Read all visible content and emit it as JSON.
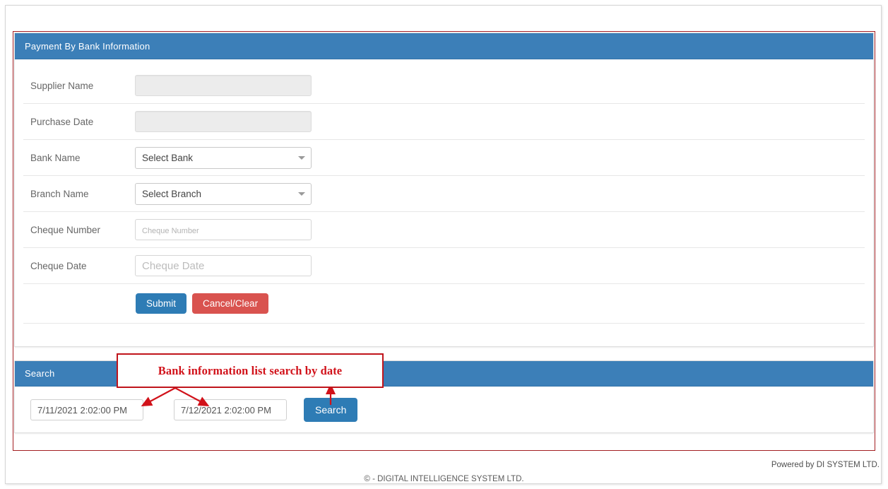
{
  "main_panel": {
    "title": "Payment By Bank Information",
    "rows": [
      {
        "label": "Supplier Name",
        "type": "text-disabled",
        "value": "",
        "placeholder": ""
      },
      {
        "label": "Purchase Date",
        "type": "text-disabled",
        "value": "",
        "placeholder": ""
      },
      {
        "label": "Bank Name",
        "type": "select",
        "value": "Select Bank",
        "placeholder": ""
      },
      {
        "label": "Branch Name",
        "type": "select",
        "value": "Select Branch",
        "placeholder": ""
      },
      {
        "label": "Cheque Number",
        "type": "text",
        "value": "",
        "placeholder": "Cheque Number"
      },
      {
        "label": "Cheque Date",
        "type": "text",
        "value": "",
        "placeholder": "Cheque Date"
      }
    ],
    "submit_label": "Submit",
    "cancel_label": "Cancel/Clear"
  },
  "search_panel": {
    "title": "Search",
    "from_date": "7/11/2021 2:02:00 PM",
    "to_date": "7/12/2021 2:02:00 PM",
    "search_label": "Search"
  },
  "annotation": {
    "text": "Bank information list search by date",
    "color": "#d1121a"
  },
  "footer": {
    "powered_by": "Powered by DI SYSTEM LTD.",
    "copyright": "©  - DIGITAL INTELLIGENCE SYSTEM LTD."
  },
  "colors": {
    "panel_header_blue": "#3c7fb8",
    "primary_button": "#2e7cb5",
    "danger_button": "#d9534f",
    "annotation_red": "#c0141b",
    "container_border": "#a31e22"
  }
}
